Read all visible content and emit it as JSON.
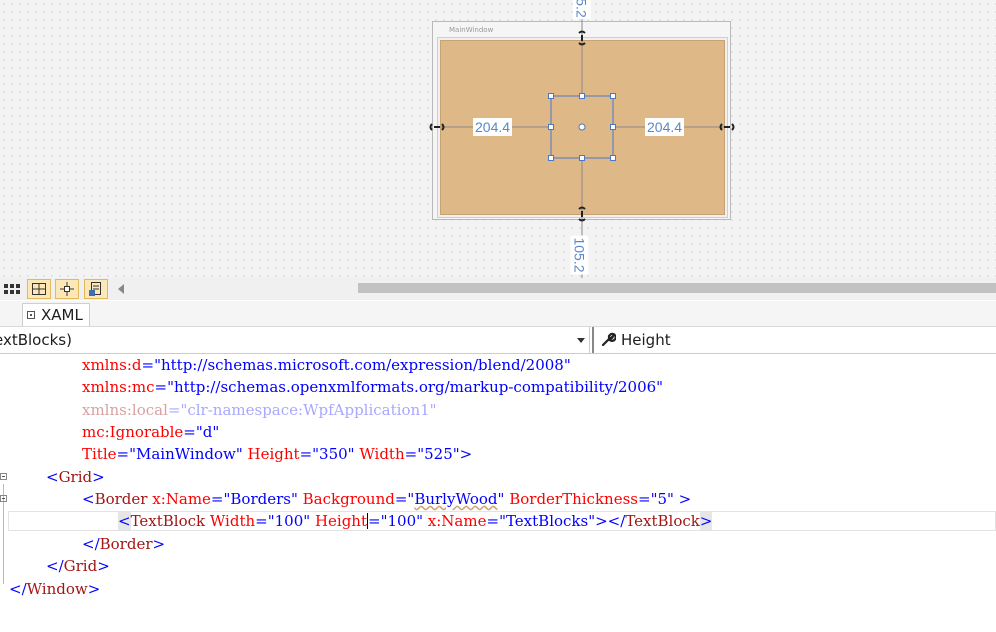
{
  "designer": {
    "window_title": "MainWindow",
    "dim_top": "5.2",
    "dim_bottom": "105.2",
    "dim_left": "204.4",
    "dim_right": "204.4",
    "border_color": "#deb887",
    "accent": "#5b87c6"
  },
  "toolbar": {
    "buttons": [
      "grid-view-icon",
      "snap-grid-icon",
      "snap-lines-icon",
      "design-data-icon"
    ]
  },
  "tab": {
    "label": "XAML"
  },
  "navbar": {
    "element_path": "extBlocks)",
    "property": "Height"
  },
  "code": {
    "l1_attr": "xmlns:d",
    "l1_val": "\"http://schemas.microsoft.com/expression/blend/2008\"",
    "l2_attr": "xmlns:mc",
    "l2_val": "\"http://schemas.openxmlformats.org/markup-compatibility/2006\"",
    "l3_attr": "xmlns:local",
    "l3_val": "\"clr-namespace:WpfApplication1\"",
    "l4_attr": "mc:Ignorable",
    "l4_val": "\"d\"",
    "l5_a1": "Title",
    "l5_v1": "\"MainWindow\"",
    "l5_a2": "Height",
    "l5_v2": "\"350\"",
    "l5_a3": "Width",
    "l5_v3": "\"525\"",
    "l5_close": ">",
    "l6_open": "<",
    "l6_tag": "Grid",
    "l6_close": ">",
    "l7_open": "<",
    "l7_tag": "Border",
    "l7_a1": "x:Name",
    "l7_v1": "\"Borders\"",
    "l7_a2": "Background",
    "l7_v2a": "\"",
    "l7_v2b": "BurlyWood",
    "l7_v2c": "\"",
    "l7_a3": "BorderThickness",
    "l7_v3": "\"5\"",
    "l7_close": " >",
    "l8_open": "<",
    "l8_tag": "TextBlock",
    "l8_a1": "Width",
    "l8_v1": "\"100\"",
    "l8_a2": "Height",
    "l8_v2": "\"100\"",
    "l8_a3": "x:Name",
    "l8_v3": "\"TextBlocks\"",
    "l8_mid": "></",
    "l8_tag2": "TextBlock",
    "l8_close": ">",
    "l9_open": "</",
    "l9_tag": "Border",
    "l9_close": ">",
    "l10_open": "</",
    "l10_tag": "Grid",
    "l10_close": ">",
    "l11_open": "</",
    "l11_tag": "Window",
    "l11_close": ">"
  }
}
